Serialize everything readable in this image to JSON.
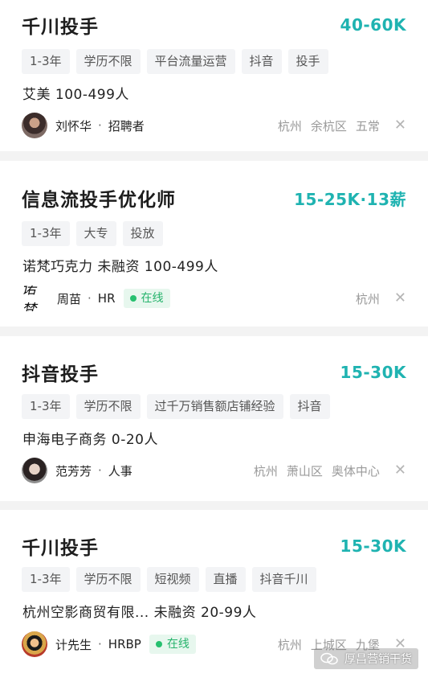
{
  "jobs": [
    {
      "title": "千川投手",
      "salary": "40-60K",
      "tags": [
        "1-3年",
        "学历不限",
        "平台流量运营",
        "抖音",
        "投手"
      ],
      "company": "艾美  100-499人",
      "recruiter": {
        "name": "刘怀华",
        "role": "招聘者",
        "avatar": "person-avatar",
        "online": ""
      },
      "location": [
        "杭州",
        "余杭区",
        "五常"
      ]
    },
    {
      "title": "信息流投手优化师",
      "salary": "15-25K·13薪",
      "tags": [
        "1-3年",
        "大专",
        "投放"
      ],
      "company": "诺梵巧克力 未融资 100-499人",
      "recruiter": {
        "name": "周苗",
        "role": "HR",
        "avatar": "诺梵",
        "online": "在线"
      },
      "location": [
        "杭州"
      ]
    },
    {
      "title": "抖音投手",
      "salary": "15-30K",
      "tags": [
        "1-3年",
        "学历不限",
        "过千万销售额店铺经验",
        "抖音"
      ],
      "company": "申海电子商务  0-20人",
      "recruiter": {
        "name": "范芳芳",
        "role": "人事",
        "avatar": "person-avatar",
        "online": ""
      },
      "location": [
        "杭州",
        "萧山区",
        "奥体中心"
      ]
    },
    {
      "title": "千川投手",
      "salary": "15-30K",
      "tags": [
        "1-3年",
        "学历不限",
        "短视频",
        "直播",
        "抖音千川"
      ],
      "company": "杭州空影商贸有限... 未融资 20-99人",
      "recruiter": {
        "name": "计先生",
        "role": "HRBP",
        "avatar": "cartoon-avatar",
        "online": "在线"
      },
      "location": [
        "杭州",
        "上城区",
        "九堡"
      ]
    }
  ],
  "close_glyph": "✕",
  "dot_glyph": "·",
  "watermark": {
    "text": "厚昌营销干货",
    "icon": "wechat-icon"
  },
  "colors": {
    "salary": "#1fb3b1",
    "online_text": "#26b36c",
    "online_bg": "#e7f7ee",
    "tag_bg": "#f3f4f6",
    "location": "#9a9a9a"
  }
}
